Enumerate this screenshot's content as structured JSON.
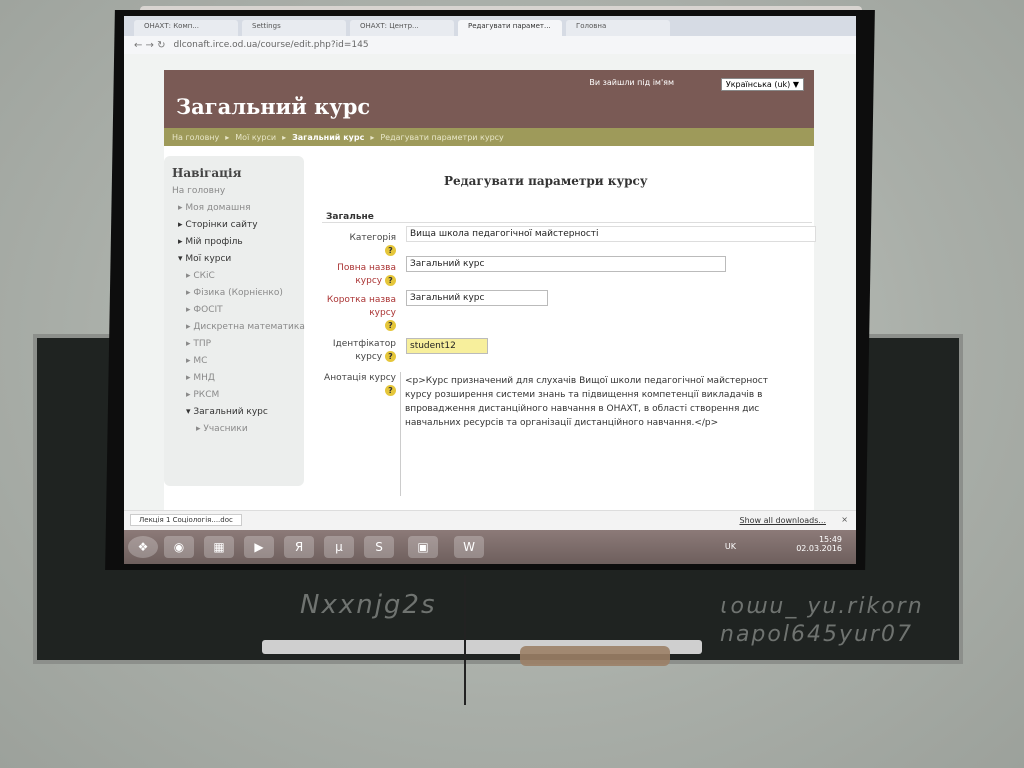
{
  "browser": {
    "tabs": [
      {
        "label": "ОНАХТ: Комп..."
      },
      {
        "label": "Settings"
      },
      {
        "label": "ОНАХТ: Центр..."
      },
      {
        "label": "Редагувати парамет..."
      },
      {
        "label": "Головна"
      }
    ],
    "url": "dlconaft.irce.od.ua/course/edit.php?id=145"
  },
  "page": {
    "site_title": "Загальний курс",
    "login_text": "Ви зайшли під ім'ям",
    "language": "Українська (uk) ▼",
    "breadcrumbs": [
      "На головну",
      "Мої курси",
      "Загальний курс",
      "Редагувати параметри курсу"
    ],
    "form_heading": "Редагувати параметри курсу",
    "legend": "Загальне"
  },
  "navigation": {
    "title": "Навігація",
    "items": [
      {
        "label": "На головну",
        "level": 0,
        "dim": true
      },
      {
        "label": "▸ Моя домашня",
        "level": 1,
        "dim": true
      },
      {
        "label": "▸ Сторінки сайту",
        "level": 1
      },
      {
        "label": "▸ Мій профіль",
        "level": 1
      },
      {
        "label": "▾ Мої курси",
        "level": 1
      },
      {
        "label": "▸ СКіС",
        "level": 2,
        "dim": true
      },
      {
        "label": "▸ Фізика (Корнієнко)",
        "level": 2,
        "dim": true
      },
      {
        "label": "▸ ФОСІТ",
        "level": 2,
        "dim": true
      },
      {
        "label": "▸ Дискретна математика",
        "level": 2,
        "dim": true
      },
      {
        "label": "▸ ТПР",
        "level": 2,
        "dim": true
      },
      {
        "label": "▸ МС",
        "level": 2,
        "dim": true
      },
      {
        "label": "▸ МНД",
        "level": 2,
        "dim": true
      },
      {
        "label": "▸ РКСМ",
        "level": 2,
        "dim": true
      },
      {
        "label": "▾ Загальний курс",
        "level": 2
      },
      {
        "label": "▸ Учасники",
        "level": 3,
        "dim": true
      }
    ]
  },
  "form": {
    "category_label": "Категорія",
    "category_value": "Вища школа педагогічної майстерності",
    "fullname_label": "Повна назва курсу",
    "fullname_value": "Загальний курс",
    "shortname_label": "Коротка назва курсу",
    "shortname_value": "Загальний курс",
    "idnumber_label": "Ідентфікатор курсу",
    "idnumber_value": "student12",
    "summary_label": "Анотація курсу",
    "summary_value": "<p>Курс призначений для слухачів Вищої школи педагогічної майстерност курсу  розширення системи знань та підвищення компетенції викладачів в впровадження дистанційного навчання в ОНАХТ, в області створення дис навчальних ресурсів та організації дистанційного навчання.</p>",
    "help_glyph": "?"
  },
  "downloads": {
    "file": "Лекція 1 Соціологія....doc",
    "show_all": "Show all downloads...",
    "close": "×"
  },
  "taskbar": {
    "language": "UK",
    "time": "15:49",
    "date": "02.03.2016"
  },
  "chalkboard": {
    "text_left": "Nxxnjg2s",
    "text_right_1": "ɩoɯu_ yu.rikorn",
    "text_right_2": "napol645yur07"
  }
}
